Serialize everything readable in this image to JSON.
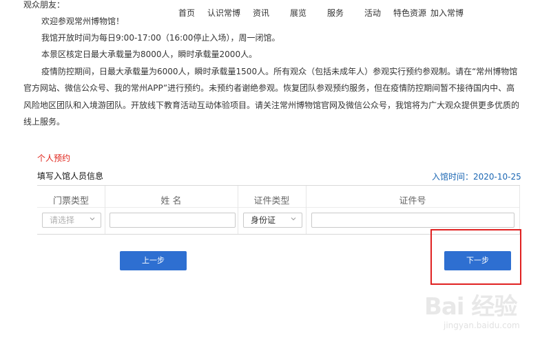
{
  "nav": {
    "items": [
      "首页",
      "认识常博",
      "资讯",
      "展览",
      "服务",
      "活动",
      "特色资源",
      "加入常博"
    ]
  },
  "notice": {
    "greeting": "观众朋友：",
    "line1": "欢迎参观常州博物馆！",
    "line2": "我馆开放时间为每日9:00-17:00（16:00停止入场），周一闭馆。",
    "line3": "本景区核定日最大承载量为8000人，瞬时承载量2000人。",
    "para_line1": "疫情防控期间，日最大承载量为6000人，瞬时承载量1500人。所有观众（包括未成年人）参观实行预约参观制。请在“常州博物馆",
    "para_line2": "官方网站、微信公众号、我的常州APP”进行预约。未预约者谢绝参观。恢复团队参观预约服务，但在疫情防控期间暂不接待国内中、高",
    "para_line3": "风险地区团队和入境游团队。开放线下教育活动互动体验项目。请关注常州博物馆官网及微信公众号，我馆将为广大观众提供更多优质的",
    "para_line4": "线上服务。"
  },
  "booking": {
    "section_title": "个人预约",
    "form_title": "填写入馆人员信息",
    "visit_date_label": "入馆时间：",
    "visit_date_value": "2020-10-25"
  },
  "table": {
    "headers": [
      "门票类型",
      "姓 名",
      "证件类型",
      "证件号"
    ],
    "ticket_type_placeholder": "请选择",
    "name_value": "",
    "id_type_value": "身份证",
    "id_number_value": ""
  },
  "buttons": {
    "prev_label": "上一步",
    "next_label": "下一步"
  },
  "watermark": {
    "main": "Bai 经验",
    "sub": "jingyan.baidu.com"
  },
  "colors": {
    "accent_blue": "#2e6fd1",
    "link_blue": "#1a66b3",
    "section_red": "#e0251c",
    "highlight_red": "#e02020"
  }
}
